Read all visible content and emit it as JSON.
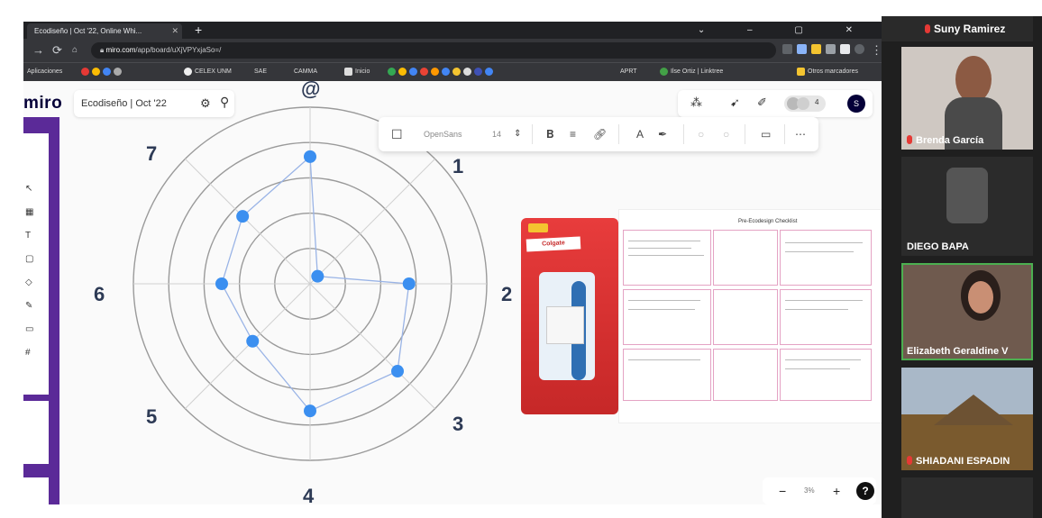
{
  "browser": {
    "tab_title": "Ecodiseño | Oct '22, Online Whi...",
    "url_domain": "miro.com",
    "url_path": "/app/board/uXjVPYxjaSo=/",
    "bookmarks": [
      "Aplicaciones",
      "CELEX UNM",
      "SAE",
      "CAMMA",
      "Inicio",
      "APRT",
      "Ilse Ortiz | Linktree",
      "Otros marcadores"
    ]
  },
  "miro": {
    "logo": "miro",
    "board_name": "Ecodiseño | Oct '22",
    "user_initial": "S",
    "avatar_count": "4",
    "font_name": "OpenSans",
    "font_size": "14",
    "zoom_label": "3%"
  },
  "radar": {
    "axis_labels": [
      "@",
      "1",
      "2",
      "3",
      "4",
      "5",
      "6",
      "7"
    ],
    "ring_count": 5,
    "values": [
      3.6,
      0.3,
      2.8,
      3.5,
      3.6,
      2.3,
      2.5,
      2.7
    ]
  },
  "document": {
    "title": "Pre-Ecodesign Checklist"
  },
  "participants": [
    {
      "name": "Suny Ramirez"
    },
    {
      "name": "Brenda García"
    },
    {
      "name": "DIEGO BAPA"
    },
    {
      "name": "Elizabeth Geraldine V"
    },
    {
      "name": "SHIADANI ESPADIN"
    }
  ],
  "colors": {
    "accent": "#5b2a98",
    "point": "#3b8ff0",
    "active_speaker": "#4caf50"
  }
}
